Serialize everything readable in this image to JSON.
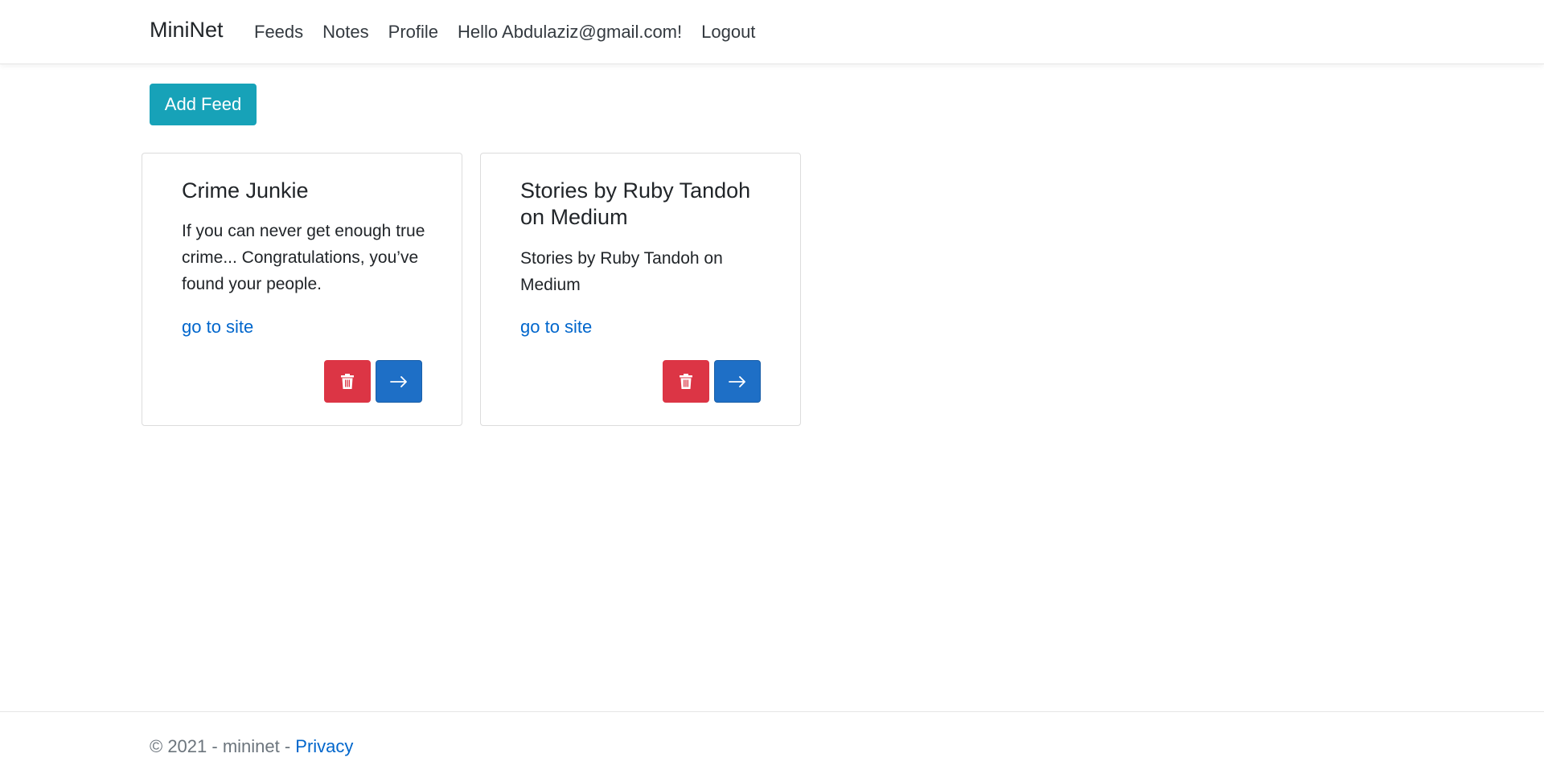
{
  "navbar": {
    "brand": "MiniNet",
    "links": [
      {
        "label": "Feeds"
      },
      {
        "label": "Notes"
      },
      {
        "label": "Profile"
      }
    ],
    "greeting": "Hello Abdulaziz@gmail.com!",
    "logout": "Logout"
  },
  "actions": {
    "add_feed_label": "Add Feed"
  },
  "feeds": [
    {
      "title": "Crime Junkie",
      "description": "If you can never get enough true crime... Congratulations, you’ve found your people.",
      "link_label": "go to site",
      "delete_icon": "trash-icon",
      "open_icon": "arrow-right-icon"
    },
    {
      "title": "Stories by Ruby Tandoh on Medium",
      "description": "Stories by Ruby Tandoh on Medium",
      "link_label": "go to site",
      "delete_icon": "trash-icon",
      "open_icon": "arrow-right-icon"
    }
  ],
  "footer": {
    "copyright": "© 2021 - mininet - ",
    "privacy_label": "Privacy"
  },
  "colors": {
    "add_button": "#17a2b8",
    "delete_button": "#dc3545",
    "open_button": "#1e6fc6",
    "link": "#0066cc"
  }
}
